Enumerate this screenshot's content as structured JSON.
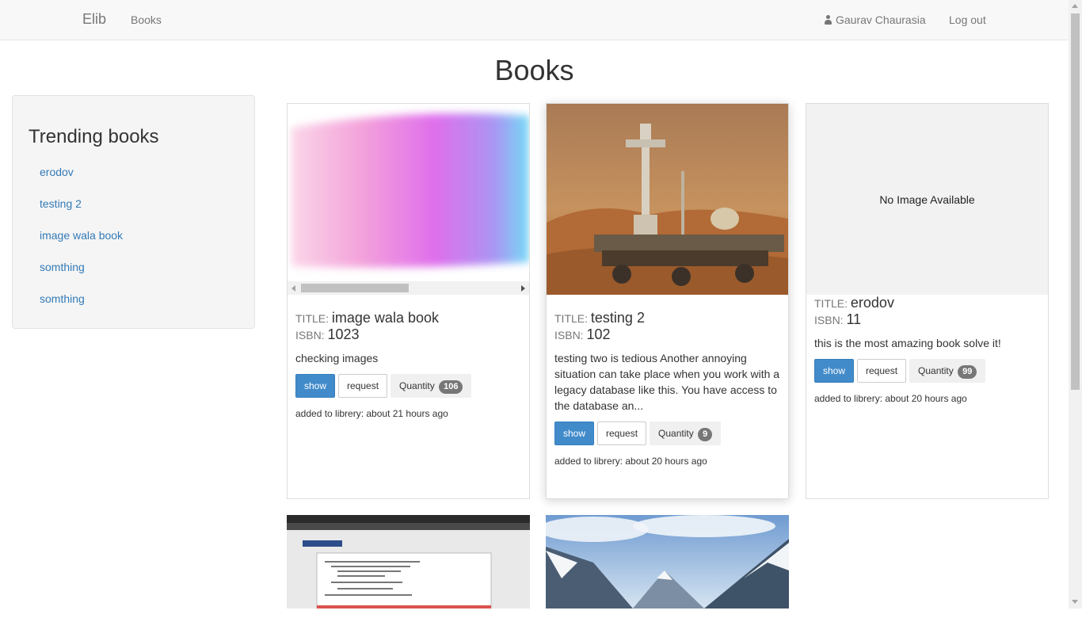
{
  "nav": {
    "brand": "Elib",
    "books_link": "Books",
    "user_name": "Gaurav Chaurasia",
    "logout": "Log out"
  },
  "page": {
    "title": "Books"
  },
  "sidebar": {
    "heading": "Trending books",
    "items": [
      "erodov",
      "testing 2",
      "image wala book",
      "somthing",
      "somthing"
    ]
  },
  "labels": {
    "title": "Title:",
    "isbn": "ISBN:",
    "show": "show",
    "request": "request",
    "quantity": "Quantity",
    "no_image": "No Image Available"
  },
  "books": [
    {
      "title": "image wala book",
      "isbn": "1023",
      "description": "checking images",
      "quantity": "106",
      "added": "added to librery: about 21 hours ago",
      "image": "paint-swatch"
    },
    {
      "title": "testing 2",
      "isbn": "102",
      "description": "testing two is tedious Another annoying situation can take place when you work with a legacy database like this. You have access to the database an...",
      "quantity": "9",
      "added": "added to librery: about 20 hours ago",
      "image": "mars-rover"
    },
    {
      "title": "erodov",
      "isbn": "11",
      "description": "this is the most amazing book solve it!",
      "quantity": "99",
      "added": "added to librery: about 20 hours ago",
      "image": "none"
    }
  ],
  "colors": {
    "link": "#337ab7",
    "primary": "#428bca",
    "navbar_bg": "#f8f8f8",
    "badge": "#777777"
  }
}
